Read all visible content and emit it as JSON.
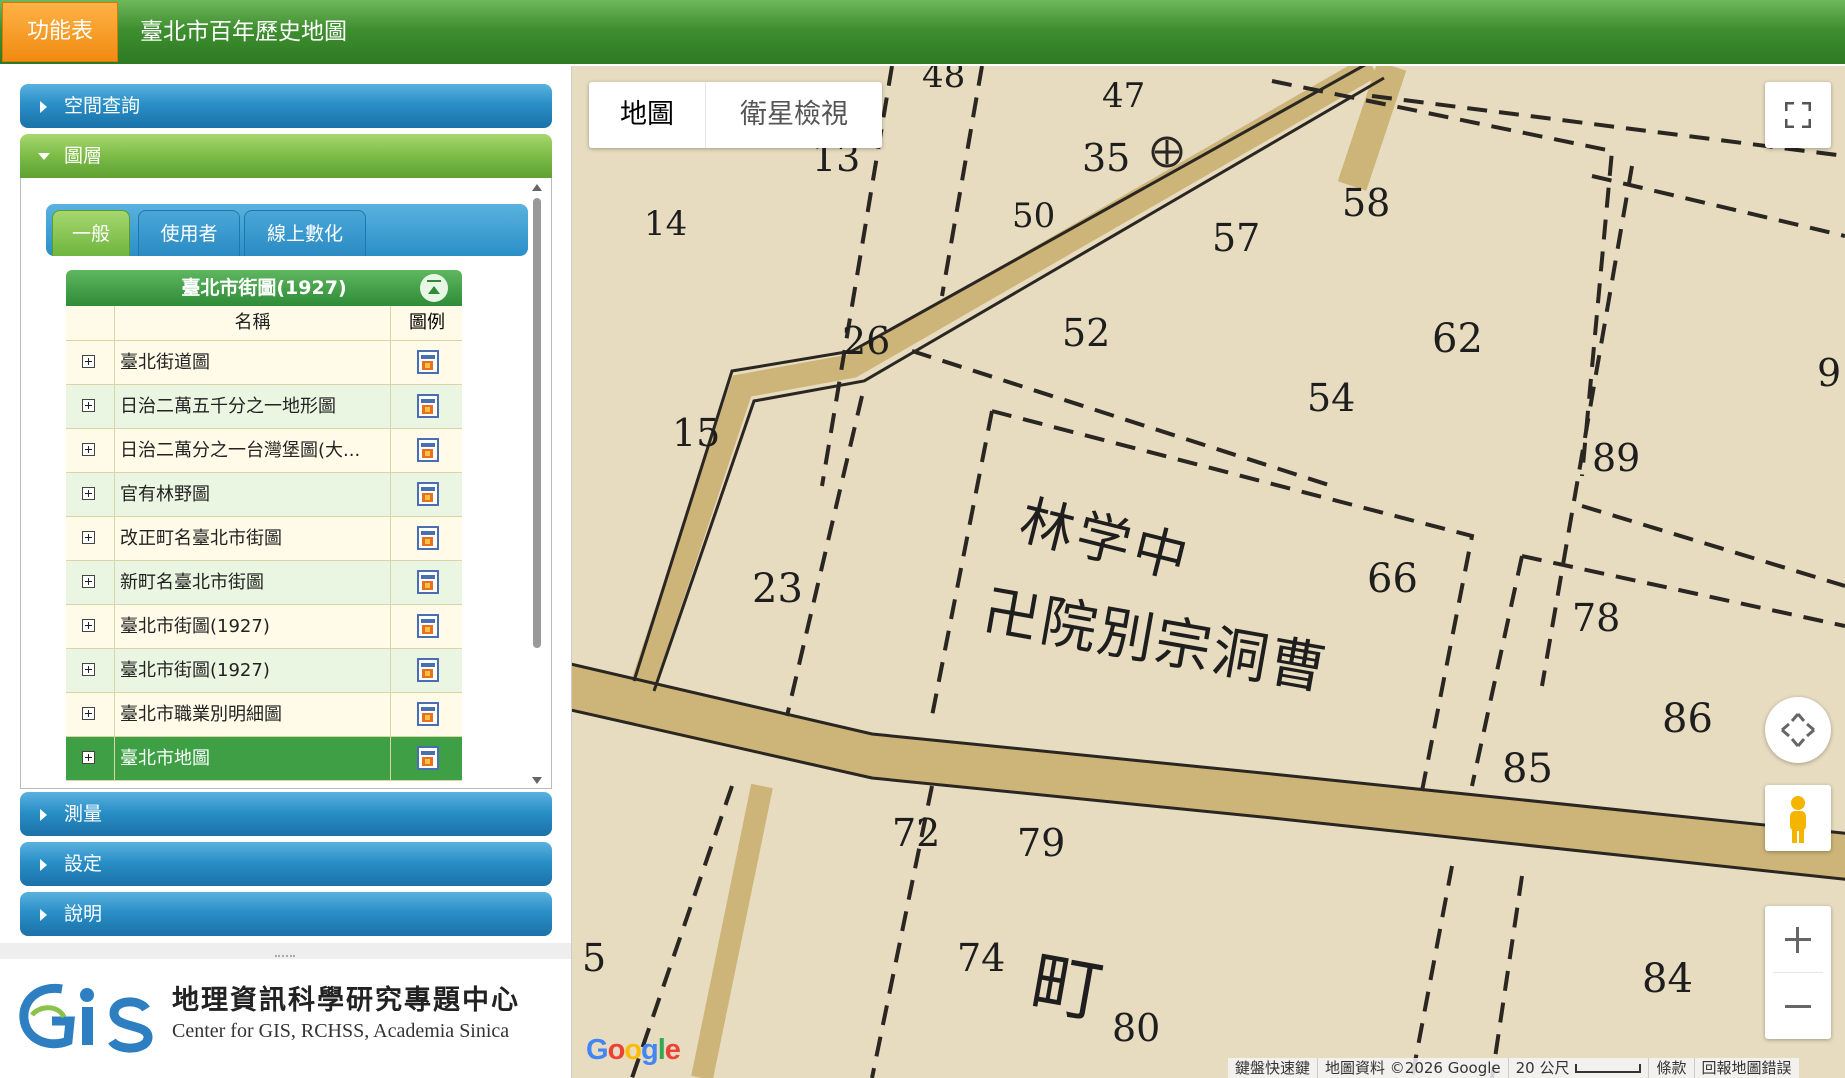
{
  "header": {
    "menu_label": "功能表",
    "title": "臺北市百年歷史地圖"
  },
  "sidebar": {
    "sections": [
      {
        "label": "空間查詢",
        "open": false
      },
      {
        "label": "圖層",
        "open": true
      },
      {
        "label": "測量",
        "open": false
      },
      {
        "label": "設定",
        "open": false
      },
      {
        "label": "說明",
        "open": false
      }
    ],
    "tabs": [
      {
        "label": "一般",
        "active": true
      },
      {
        "label": "使用者",
        "active": false
      },
      {
        "label": "線上數化",
        "active": false
      }
    ],
    "layer_table": {
      "title": "臺北市街圖(1927)",
      "columns": [
        "名稱",
        "圖例"
      ],
      "rows": [
        {
          "name": "臺北街道圖"
        },
        {
          "name": "日治二萬五千分之一地形圖"
        },
        {
          "name": "日治二萬分之一台灣堡圖(大..."
        },
        {
          "name": "官有林野圖"
        },
        {
          "name": "改正町名臺北市街圖"
        },
        {
          "name": "新町名臺北市街圖"
        },
        {
          "name": "臺北市街圖(1927)"
        },
        {
          "name": "臺北市街圖(1927)"
        },
        {
          "name": "臺北市職業別明細圖"
        },
        {
          "name": "臺北市地圖",
          "selected": true
        }
      ]
    },
    "logo": {
      "zh": "地理資訊科學研究專題中心",
      "en": "Center for GIS, RCHSS, Academia Sinica"
    }
  },
  "map": {
    "type_buttons": {
      "map": "地圖",
      "satellite": "衛星檢視"
    },
    "google_logo": "Google",
    "attribution": {
      "shortcuts": "鍵盤快速鍵",
      "data": "地圖資料 ©2026 Google",
      "scale": "20 公尺",
      "terms": "條款",
      "report": "回報地圖錯誤"
    },
    "labels": {
      "lot_numbers": [
        "48",
        "47",
        "13",
        "35",
        "58",
        "14",
        "50",
        "57",
        "26",
        "52",
        "62",
        "15",
        "54",
        "89",
        "9",
        "23",
        "66",
        "78",
        "85",
        "86",
        "72",
        "79",
        "5",
        "74",
        "84",
        "80"
      ],
      "text_1": "林学中",
      "text_2": "卍院別宗洞曹",
      "text_3": "町"
    },
    "colors": {
      "paper": "#e7dcc0",
      "road": "#d6bf85",
      "ink": "#2a2622"
    }
  }
}
